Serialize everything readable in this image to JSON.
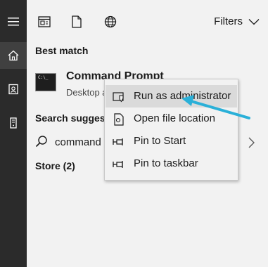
{
  "topbar": {
    "filters_label": "Filters"
  },
  "best_match": {
    "heading": "Best match",
    "app_name": "Command Prompt",
    "app_subtitle": "Desktop app",
    "icon_text": "C:\\_"
  },
  "suggestions": {
    "heading": "Search suggestions",
    "item": "command"
  },
  "store": {
    "heading": "Store (2)"
  },
  "context_menu": {
    "items": [
      {
        "label": "Run as administrator",
        "icon": "shield-icon"
      },
      {
        "label": "Open file location",
        "icon": "file-location-icon"
      },
      {
        "label": "Pin to Start",
        "icon": "pin-icon"
      },
      {
        "label": "Pin to taskbar",
        "icon": "pin-icon"
      }
    ]
  },
  "colors": {
    "sidebar_bg": "#2b2b2b",
    "panel_bg": "#f2f2f2",
    "hover_bg": "#dadada",
    "arrow": "#2ab0d8"
  }
}
